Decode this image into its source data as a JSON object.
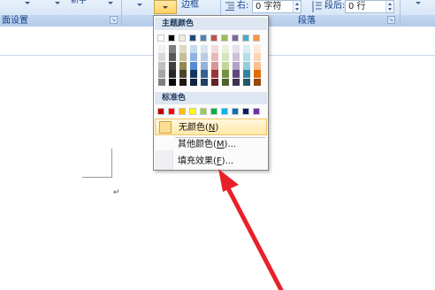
{
  "ribbon": {
    "top_left_text": "新字",
    "border_label": "边框",
    "right_indent_label": "右:",
    "right_indent_value": "0 字符",
    "space_after_label": "段后:",
    "space_after_value": "0 行",
    "group_page_setup": "面设置",
    "group_paragraph": "段落"
  },
  "dropdown": {
    "theme_colors_header": "主题颜色",
    "standard_colors_header": "标准色",
    "theme_top_row": [
      "#ffffff",
      "#000000",
      "#eeece1",
      "#1f497d",
      "#4f81bd",
      "#c0504d",
      "#9bbb59",
      "#8064a2",
      "#4bacc6",
      "#f79646"
    ],
    "theme_tints": [
      [
        "#f2f2f2",
        "#d8d8d8",
        "#bfbfbf",
        "#a5a5a5",
        "#7f7f7f"
      ],
      [
        "#7f7f7f",
        "#595959",
        "#3f3f3f",
        "#262626",
        "#0c0c0c"
      ],
      [
        "#ddd9c3",
        "#c4bd97",
        "#938953",
        "#494429",
        "#1d1b10"
      ],
      [
        "#c6d9f0",
        "#8db3e2",
        "#548dd4",
        "#17365d",
        "#0f243e"
      ],
      [
        "#dbe5f1",
        "#b8cce4",
        "#95b3d7",
        "#366092",
        "#244061"
      ],
      [
        "#f2dcdb",
        "#e5b9b7",
        "#d99694",
        "#953734",
        "#632423"
      ],
      [
        "#ebf1dd",
        "#d7e3bc",
        "#c3d69b",
        "#76923c",
        "#4f6128"
      ],
      [
        "#e5e0ec",
        "#ccc1d9",
        "#b2a2c7",
        "#5f497a",
        "#3f3151"
      ],
      [
        "#dbeef3",
        "#b7dde8",
        "#92cddc",
        "#31859b",
        "#205867"
      ],
      [
        "#fdeada",
        "#fbd5b5",
        "#fac08f",
        "#e36c09",
        "#974806"
      ]
    ],
    "standard_colors": [
      "#c00000",
      "#ff0000",
      "#ffc000",
      "#ffff00",
      "#92d050",
      "#00b050",
      "#00b0f0",
      "#0070c0",
      "#002060",
      "#7030a0"
    ],
    "no_color_label": "无颜色(",
    "no_color_key": "N",
    "no_color_tail": ")",
    "more_colors_label": "其他颜色(",
    "more_colors_key": "M",
    "more_colors_tail": ")...",
    "fill_effects_label": "填充效果(",
    "fill_effects_key": "F",
    "fill_effects_tail": ")..."
  },
  "document": {
    "paragraph_mark": "↵"
  },
  "colors": {
    "annotation_arrow": "#e8202a"
  },
  "icons": [
    "dropdown-arrow-icon",
    "launcher-icon",
    "border-icon",
    "indent-right-icon",
    "spacing-after-icon",
    "spin-arrows-icon",
    "annotation-arrow-icon"
  ]
}
